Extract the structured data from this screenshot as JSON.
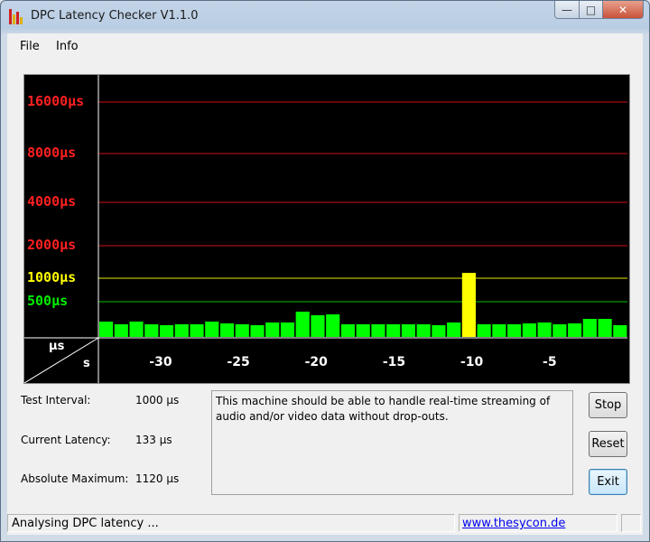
{
  "window": {
    "title": "DPC Latency Checker V1.1.0"
  },
  "menu": {
    "items": [
      "File",
      "Info"
    ]
  },
  "chart_data": {
    "type": "bar",
    "y_axis": {
      "unit_label": "µs",
      "ticks": [
        {
          "label": "16000µs",
          "color": "#ff2020"
        },
        {
          "label": "8000µs",
          "color": "#ff2020"
        },
        {
          "label": "4000µs",
          "color": "#ff2020"
        },
        {
          "label": "2000µs",
          "color": "#ff2020"
        },
        {
          "label": "1000µs",
          "color": "#ffff00"
        },
        {
          "label": "500µs",
          "color": "#00ee00"
        }
      ],
      "gridline_colors": [
        "#cc1010",
        "#cc1010",
        "#cc1010",
        "#cc1010",
        "#e6e600",
        "#00c000"
      ]
    },
    "x_axis": {
      "unit_label": "s",
      "tick_labels": [
        "-30",
        "-25",
        "-20",
        "-15",
        "-10",
        "-5"
      ],
      "range": [
        -34,
        0
      ]
    },
    "bars_latency_us": [
      135,
      120,
      135,
      120,
      115,
      120,
      120,
      135,
      125,
      120,
      115,
      130,
      130,
      190,
      170,
      175,
      120,
      120,
      120,
      120,
      120,
      120,
      115,
      130,
      1120,
      120,
      120,
      120,
      125,
      130,
      120,
      125,
      150,
      150,
      115
    ],
    "bar_colors": {
      "normal": "#00ff00",
      "warning": "#ffff00"
    },
    "grid": true
  },
  "info": {
    "test_interval_label": "Test Interval:",
    "test_interval_value": "1000 µs",
    "current_latency_label": "Current Latency:",
    "current_latency_value": "133 µs",
    "absolute_maximum_label": "Absolute Maximum:",
    "absolute_maximum_value": "1120 µs"
  },
  "message": "This machine should be able to handle real-time streaming of audio and/or video data without drop-outs.",
  "buttons": {
    "stop": "Stop",
    "reset": "Reset",
    "exit": "Exit"
  },
  "status": {
    "text": "Analysing DPC latency ...",
    "link": "www.thesycon.de"
  }
}
